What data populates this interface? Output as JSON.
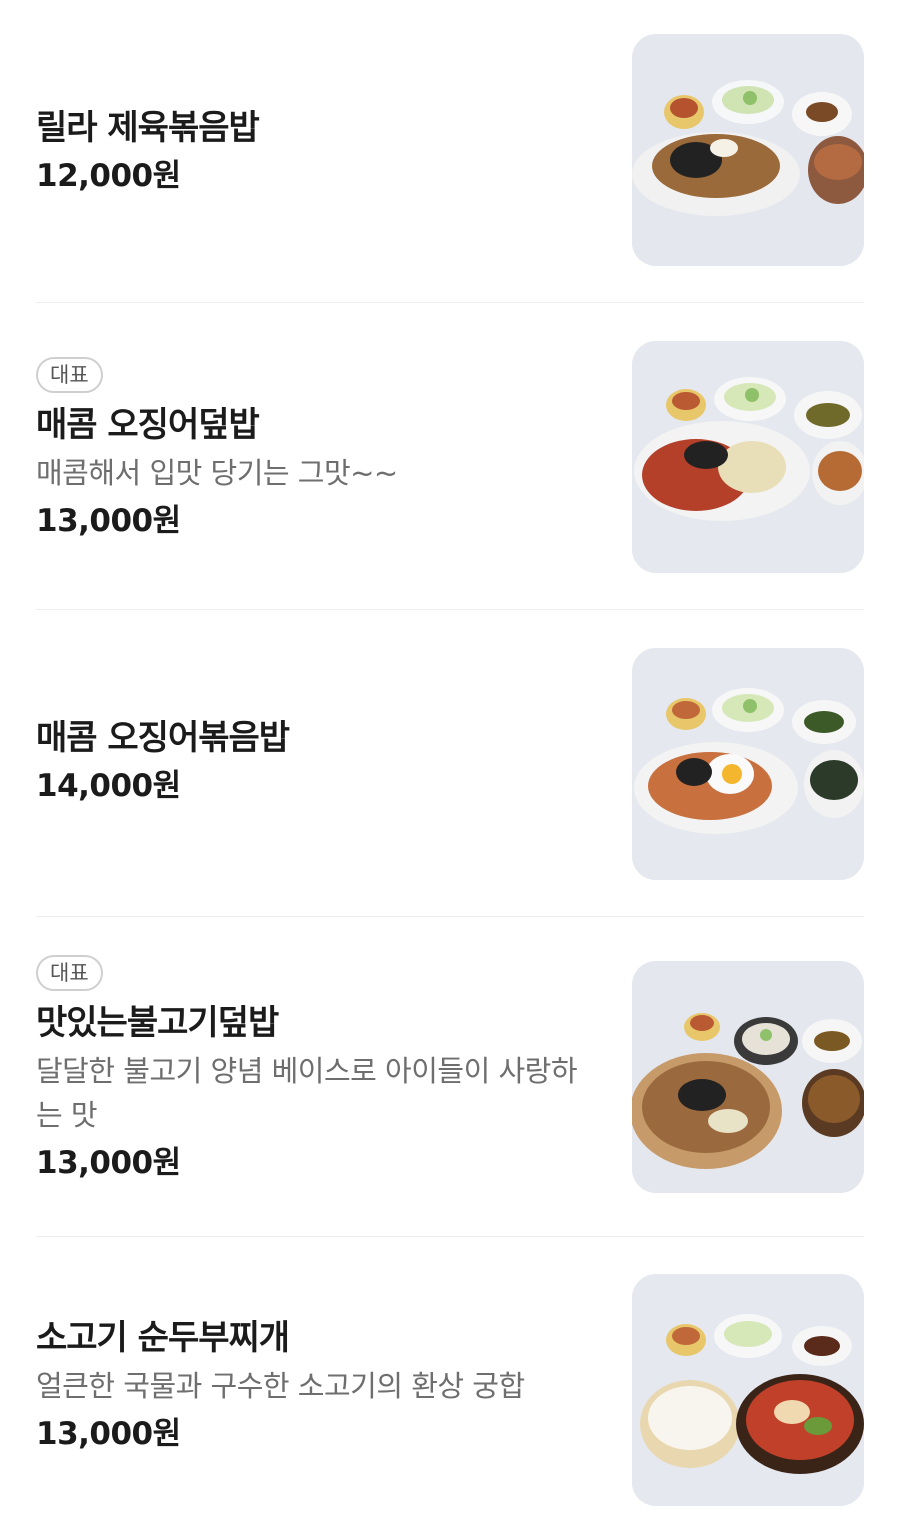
{
  "menu": {
    "items": [
      {
        "badge": "",
        "name": "릴라 제육볶음밥",
        "description": "",
        "price": "12,000원",
        "image": "jeyuk-fried-rice-photo"
      },
      {
        "badge": "대표",
        "name": "매콤 오징어덮밥",
        "description": "매콤해서 입맛 당기는 그맛~~",
        "price": "13,000원",
        "image": "spicy-squid-rice-bowl-photo"
      },
      {
        "badge": "",
        "name": "매콤 오징어볶음밥",
        "description": "",
        "price": "14,000원",
        "image": "spicy-squid-fried-rice-photo"
      },
      {
        "badge": "대표",
        "name": "맛있는불고기덮밥",
        "description": "달달한 불고기 양념 베이스로 아이들이 사랑하는 맛",
        "price": "13,000원",
        "image": "bulgogi-rice-bowl-photo"
      },
      {
        "badge": "",
        "name": "소고기 순두부찌개",
        "description": "얼큰한 국물과 구수한 소고기의 환상 궁합",
        "price": "13,000원",
        "image": "beef-soft-tofu-stew-photo"
      }
    ]
  },
  "colors": {
    "text": "#1b1b1b",
    "description": "#6e6e6e",
    "badge_border": "#cfcfcf",
    "divider": "#ededed"
  }
}
